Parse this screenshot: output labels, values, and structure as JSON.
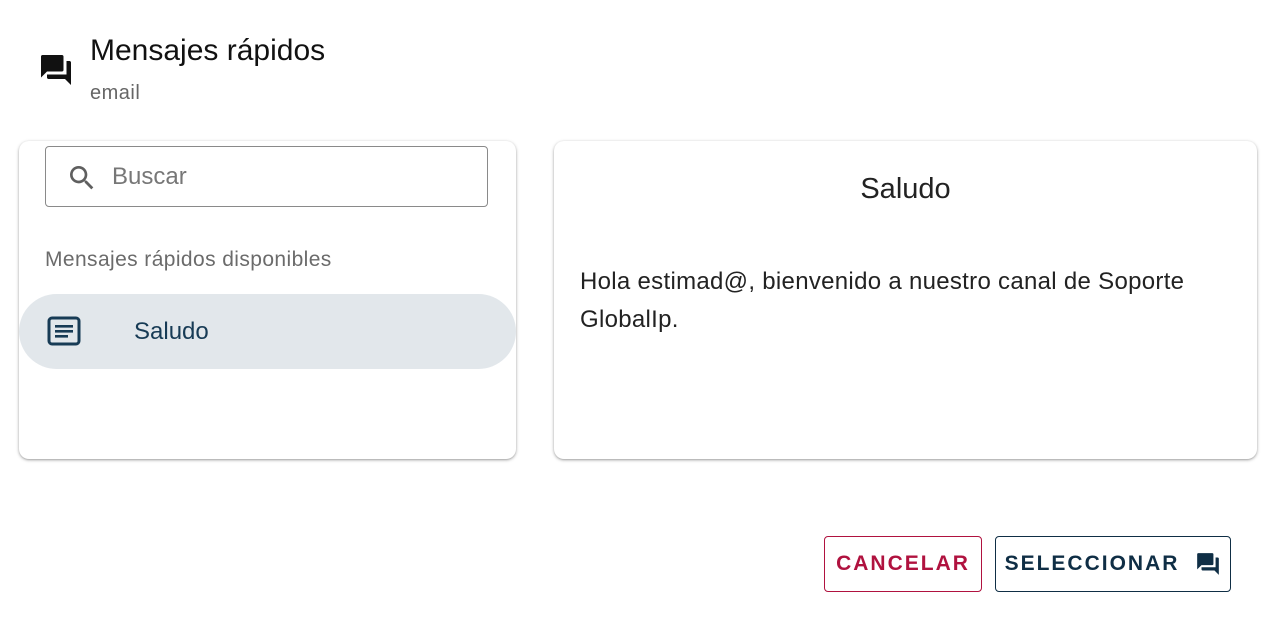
{
  "header": {
    "icon": "forum-icon",
    "title": "Mensajes rápidos",
    "subtitle": "email"
  },
  "search": {
    "placeholder": "Buscar",
    "value": "",
    "icon": "search-icon"
  },
  "list": {
    "section_label": "Mensajes rápidos disponibles",
    "items": [
      {
        "icon": "message-lines-icon",
        "label": "Saludo",
        "selected": true
      }
    ]
  },
  "preview": {
    "title": "Saludo",
    "body": "Hola estimad@, bienvenido a nuestro canal de Soporte GlobalIp."
  },
  "actions": {
    "cancel_label": "CANCELAR",
    "select_label": "SELECCIONAR",
    "select_icon": "forum-icon"
  },
  "colors": {
    "cancel": "#b0123f",
    "primary": "#0f2e45",
    "selected_item_bg": "#e2e7eb",
    "selected_item_text": "#173b55"
  }
}
